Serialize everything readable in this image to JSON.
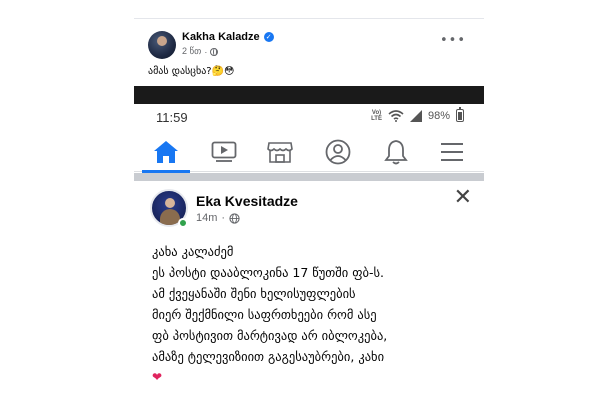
{
  "top_post": {
    "author": "Kakha Kaladze",
    "time": "2 წთ",
    "text": "ამას დასცხა?🤔😳",
    "more_label": "•••"
  },
  "phone": {
    "status": {
      "time": "11:59",
      "volte_top": "Vo)",
      "volte_bottom": "LTE",
      "battery": "98%"
    },
    "nav": {
      "items": [
        "home-icon",
        "watch-icon",
        "marketplace-icon",
        "profile-icon",
        "notifications-icon",
        "menu-icon"
      ],
      "active": "home-icon",
      "accent_color": "#1877f2"
    },
    "post": {
      "author": "Eka Kvesitadze",
      "time": "14m",
      "close_label": "✕",
      "lines": [
        "კახა კალაძემ",
        "ეს პოსტი დააბლოკინა 17 წუთში ფბ-ს.",
        "ამ ქვეყანაში შენი ხელისუფლების",
        "მიერ შექმნილი საფრთხეები რომ ასე",
        "ფბ პოსტივით მარტივად არ იბლოკება,",
        "ამაზე ტელევიზიით გაგესაუბრები,  კახი"
      ],
      "heart": "❤"
    }
  }
}
